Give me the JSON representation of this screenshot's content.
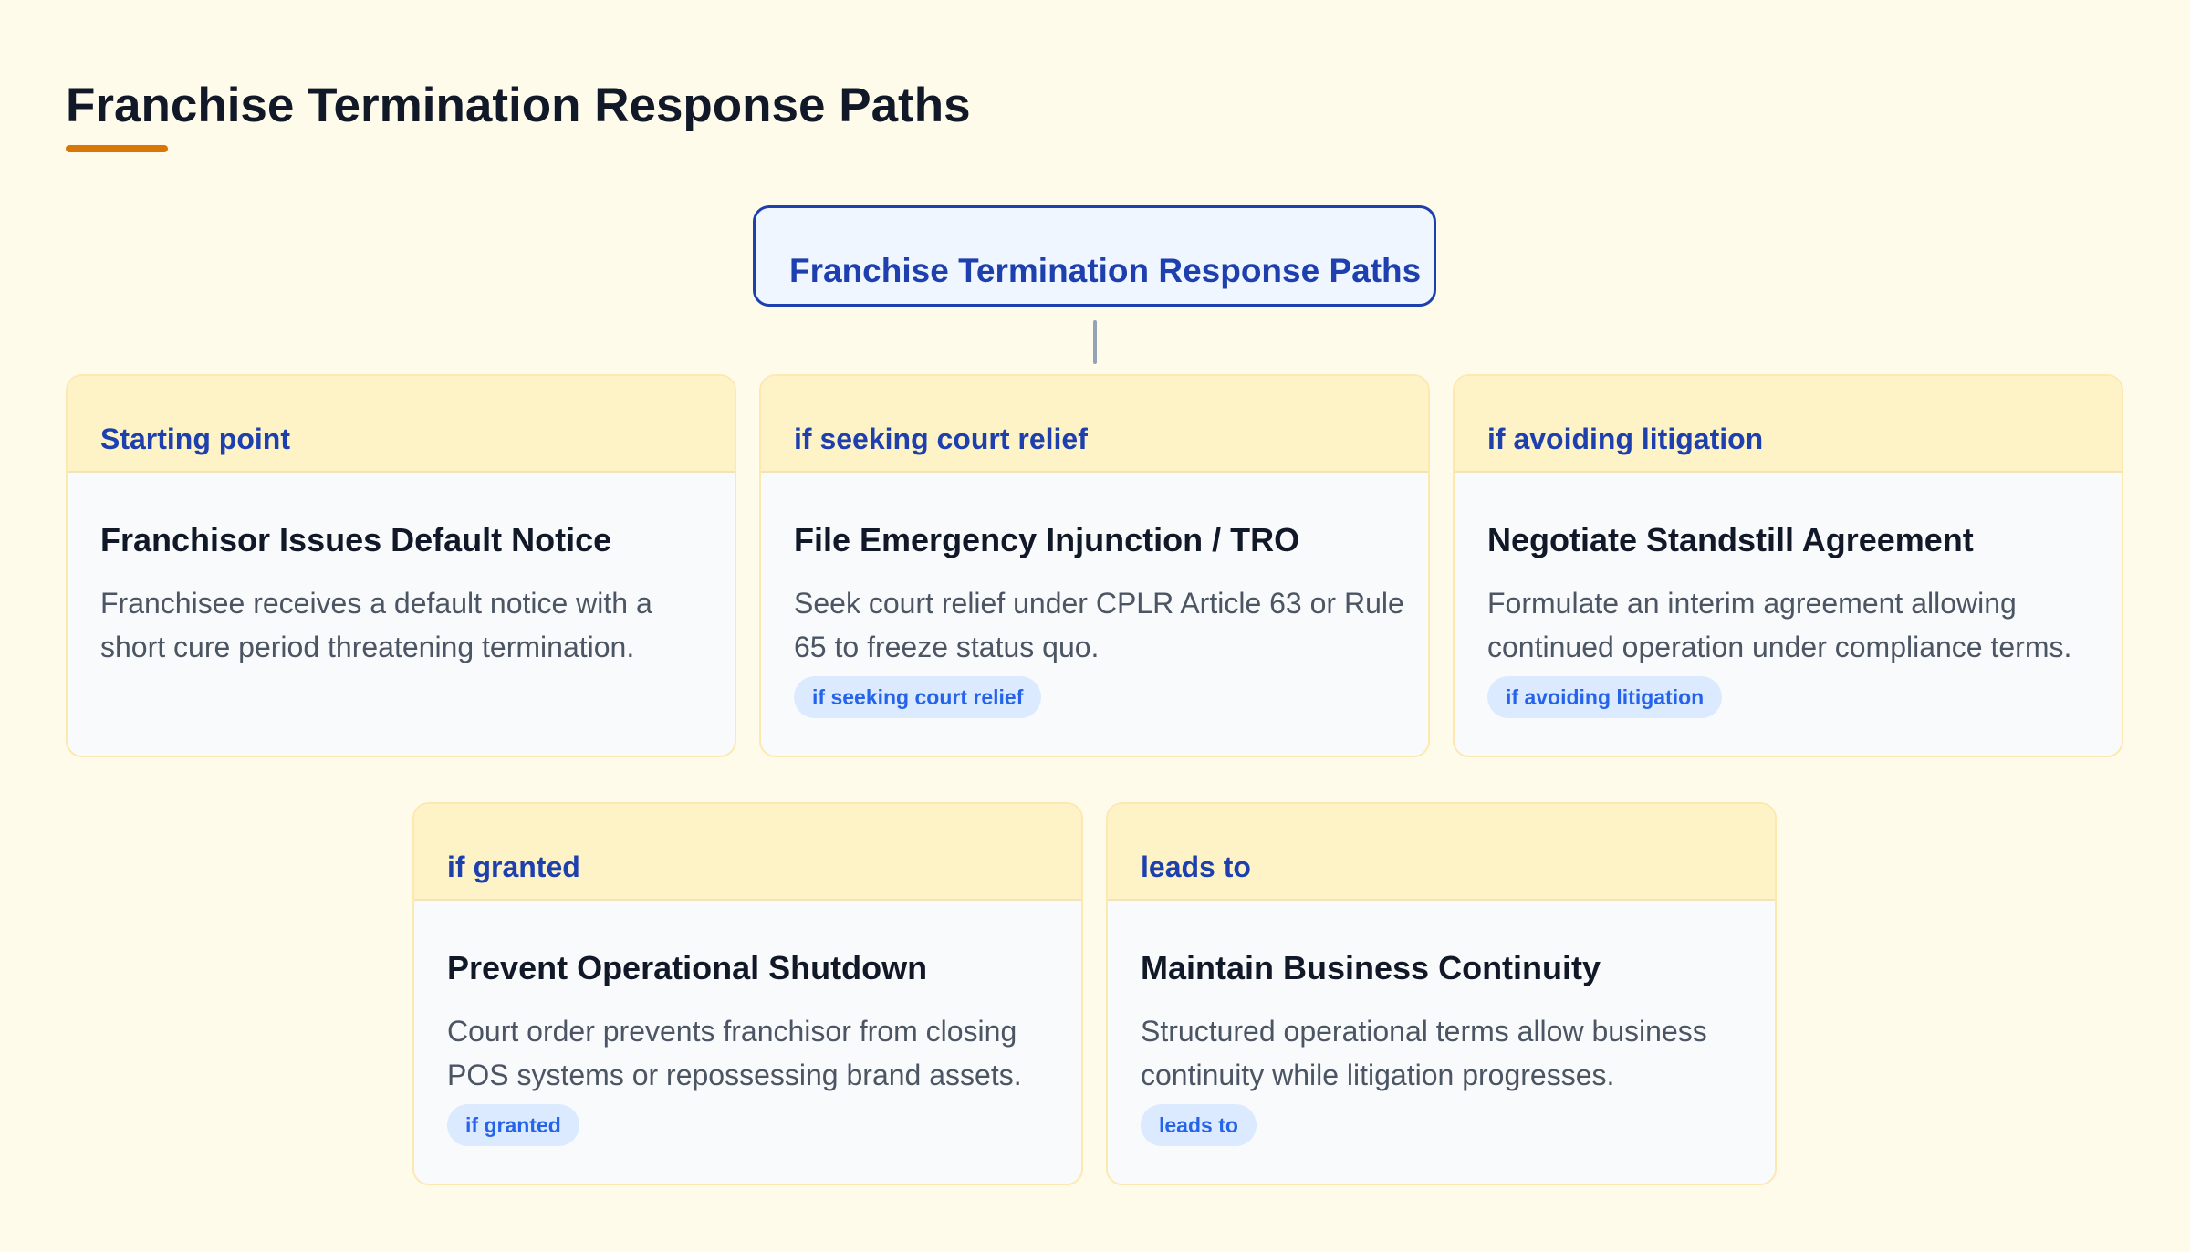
{
  "page": {
    "title": "Franchise Termination Response Paths",
    "accent_color": "#d97706"
  },
  "root": {
    "label": "Franchise Termination Response Paths"
  },
  "nodes": [
    {
      "condition": "Starting point",
      "title": "Franchisor Issues Default Notice",
      "description": "Franchisee receives a default notice with a short cure period threatening termination.",
      "badge": ""
    },
    {
      "condition": "if seeking court relief",
      "title": "File Emergency Injunction / TRO",
      "description": "Seek court relief under CPLR Article 63 or Rule 65 to freeze status quo.",
      "badge": "if seeking court relief"
    },
    {
      "condition": "if avoiding litigation",
      "title": "Negotiate Standstill Agreement",
      "description": "Formulate an interim agreement allowing continued operation under compliance terms.",
      "badge": "if avoiding litigation"
    },
    {
      "condition": "if granted",
      "title": "Prevent Operational Shutdown",
      "description": "Court order prevents franchisor from closing POS systems or repossessing brand assets.",
      "badge": "if granted"
    },
    {
      "condition": "leads to",
      "title": "Maintain Business Continuity",
      "description": "Structured operational terms allow business continuity while litigation progresses.",
      "badge": "leads to"
    }
  ]
}
